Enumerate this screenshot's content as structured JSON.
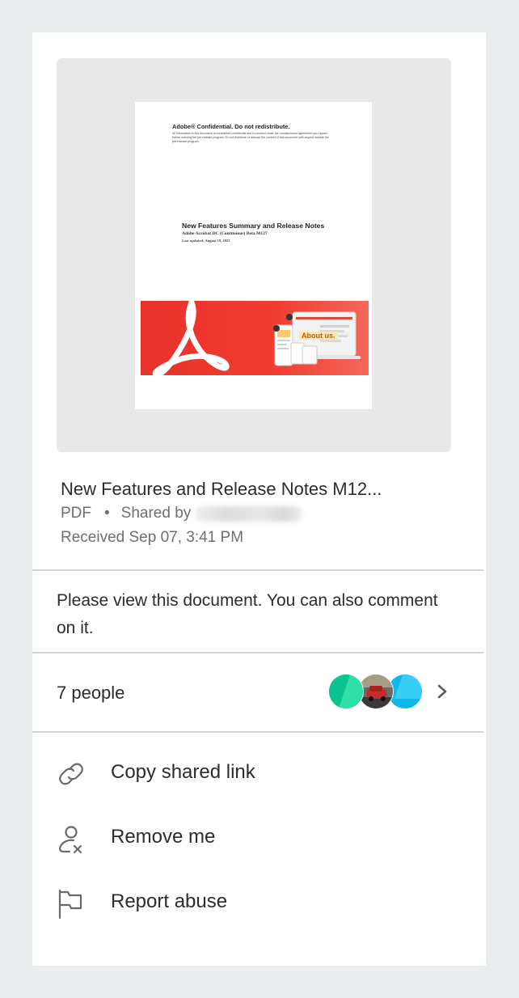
{
  "preview": {
    "confidential_title": "Adobe® Confidential. Do not redistribute.",
    "confidential_body": "All information in this document is considered confidential and is covered under the nondisclosure agreement you signed before entering the pre-release program. Do not distribute or discuss the content of this document with anyone outside the pre-release program.",
    "doc_title": "New Features Summary and Release Notes",
    "doc_subtitle": "Adobe Acrobat DC (Continuous) Beta M127",
    "doc_updated": "Last updated: August 19, 2023",
    "banner_badge": "About us."
  },
  "file": {
    "name": "New Features and Release Notes M12...",
    "type": "PDF",
    "separator": "•",
    "shared_by_label": "Shared by",
    "received": "Received Sep 07, 3:41 PM"
  },
  "message": "Please view this document. You can also comment on it.",
  "people": {
    "count_label": "7 people"
  },
  "menu": {
    "copy_link": "Copy shared link",
    "remove_me": "Remove me",
    "report_abuse": "Report abuse"
  },
  "icons": {
    "link": "link-icon",
    "remove_user": "remove-user-icon",
    "flag": "flag-icon",
    "chevron": "chevron-right-icon"
  },
  "colors": {
    "page_background": "#e9eded",
    "card_background": "#ffffff",
    "thumbnail_background": "#e8e8e8",
    "text_primary": "#2c2c2c",
    "text_secondary": "#6e6e6e",
    "divider": "#d3d3d3",
    "acrobat_red": "#f03a2c",
    "avatar_green": "#0cc392",
    "avatar_cyan": "#10b7e8"
  }
}
